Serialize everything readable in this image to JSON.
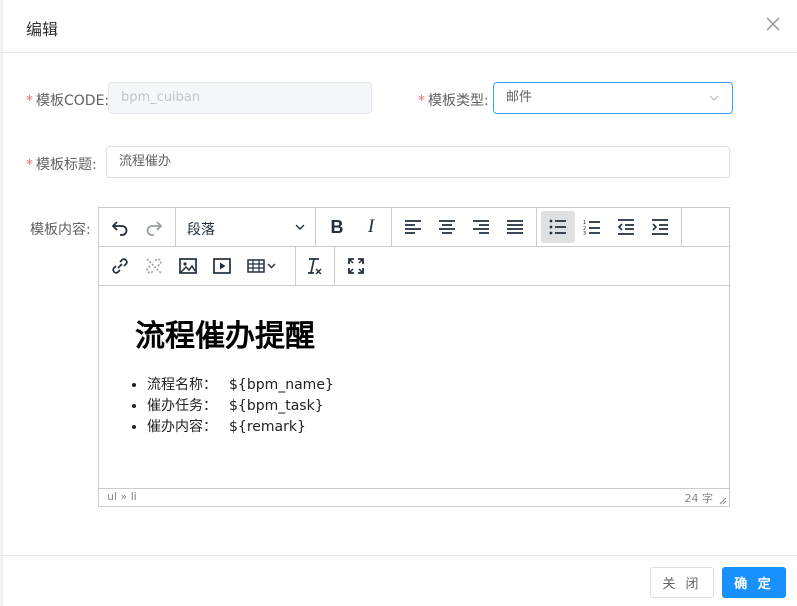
{
  "dialog": {
    "title": "编辑"
  },
  "form": {
    "code": {
      "label": "模板CODE:",
      "value": "bpm_cuiban"
    },
    "type": {
      "label": "模板类型:",
      "value": "邮件"
    },
    "title": {
      "label": "模板标题:",
      "value": "流程催办"
    },
    "content": {
      "label": "模板内容:"
    }
  },
  "editor": {
    "block_format": "段落",
    "heading": "流程催办提醒",
    "items": [
      {
        "label": "流程名称：",
        "value": "${bpm_name}"
      },
      {
        "label": "催办任务：",
        "value": "${bpm_task}"
      },
      {
        "label": "催办内容：",
        "value": "${remark}"
      }
    ],
    "path": "ul » li",
    "word_count": "24 字"
  },
  "footer": {
    "close_label": "关 闭",
    "ok_label": "确 定"
  },
  "colors": {
    "primary": "#1890ff",
    "required": "#f56c6c",
    "focus_border": "#409eff"
  }
}
